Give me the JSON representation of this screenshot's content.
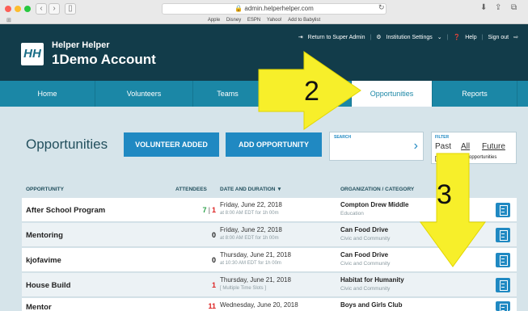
{
  "browser": {
    "url": "admin.helperhelper.com",
    "favorites": [
      "Apple",
      "Disney",
      "ESPN",
      "Yahoo!",
      "Add to Babylist"
    ]
  },
  "header": {
    "logo_text": "HH",
    "brand_line1": "Helper Helper",
    "brand_line2": "1Demo Account",
    "links": {
      "return_admin": "Return to Super Admin",
      "institution_settings": "Institution Settings",
      "help": "Help",
      "sign_out": "Sign out"
    }
  },
  "nav": {
    "tabs": [
      "Home",
      "Volunteers",
      "Teams",
      "",
      "Opportunities",
      "Reports"
    ],
    "active": "Opportunities"
  },
  "page": {
    "title": "Opportunities",
    "volunteer_added_label": "VOLUNTEER ADDED",
    "add_opportunity_label": "ADD OPPORTUNITY",
    "search_label": "SEARCH",
    "filter": {
      "label": "FILTER",
      "past": "Past",
      "all": "All",
      "future": "Future",
      "empty_label": "Hide empty opportunities"
    }
  },
  "table": {
    "headers": {
      "opportunity": "OPPORTUNITY",
      "attendees": "ATTENDEES",
      "date": "DATE AND DURATION ▼",
      "org": "ORGANIZATION / CATEGORY"
    },
    "rows": [
      {
        "name": "After School Program",
        "att_green": "7",
        "att_red": "1",
        "date": "Friday, June 22, 2018",
        "sub": "at 8:00 AM EDT for 1h 00m",
        "org": "Compton Drew Middle",
        "cat": "Education"
      },
      {
        "name": "Mentoring",
        "att": "0",
        "date": "Friday, June 22, 2018",
        "sub": "at 8:00 AM EDT for 1h 00m",
        "org": "Can Food Drive",
        "cat": "Civic and Community"
      },
      {
        "name": "kjofavime",
        "att": "0",
        "date": "Thursday, June 21, 2018",
        "sub": "at 10:30 AM EDT for 1h 00m",
        "org": "Can Food Drive",
        "cat": "Civic and Community"
      },
      {
        "name": "House Build",
        "att_red_only": "1",
        "date": "Thursday, June 21, 2018",
        "sub": "[ Multiple Time Slots ]",
        "org": "Habitat for Humanity",
        "cat": "Civic and Community"
      },
      {
        "name": "Mentor",
        "att_red_only": "11",
        "date": "Wednesday, June 20, 2018",
        "sub": "",
        "org": "Boys and Girls Club",
        "cat": ""
      }
    ]
  },
  "annotations": [
    "2",
    "3"
  ],
  "colors": {
    "header_bg": "#123c4a",
    "nav_bg": "#1b87a6",
    "button_blue": "#2089c2",
    "arrow_yellow": "#f7ef2a"
  }
}
